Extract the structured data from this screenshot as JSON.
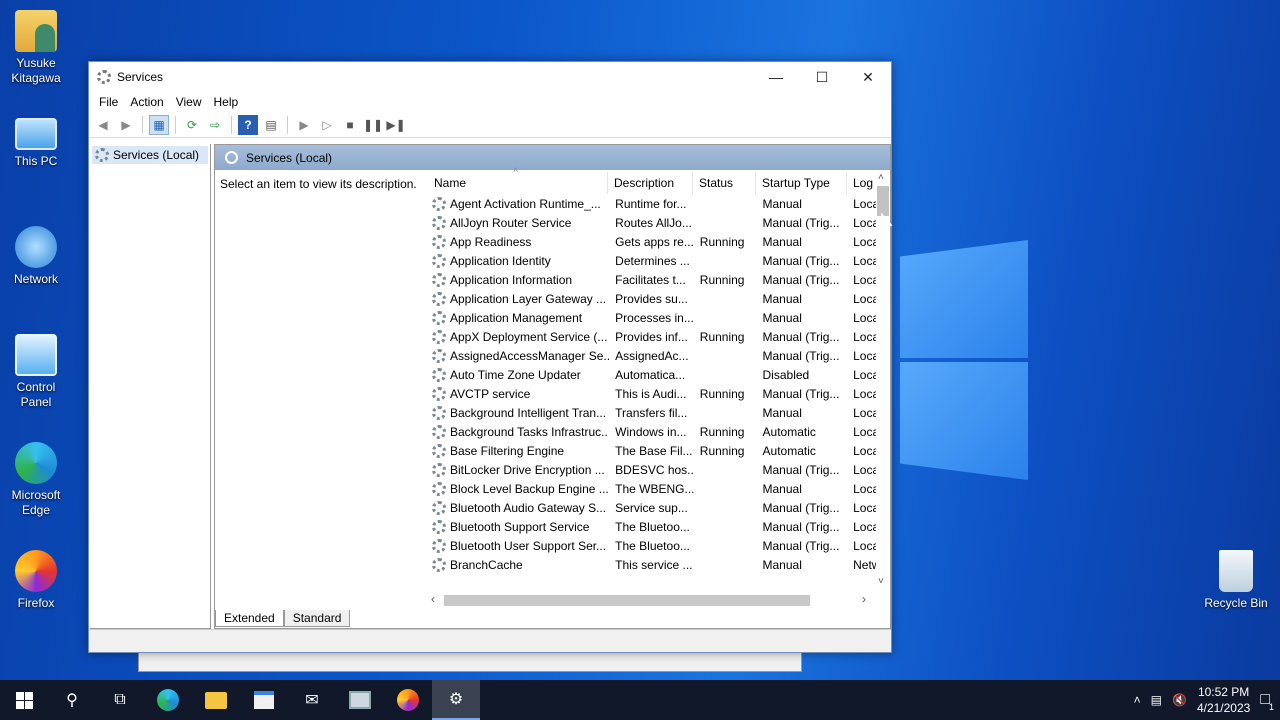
{
  "desktop": {
    "icons": [
      {
        "label": "Yusuke\nKitagawa",
        "icon": "user-folder-icon"
      },
      {
        "label": "This PC",
        "icon": "computer-icon"
      },
      {
        "label": "Network",
        "icon": "network-icon"
      },
      {
        "label": "Control\nPanel",
        "icon": "control-panel-icon"
      },
      {
        "label": "Microsoft\nEdge",
        "icon": "edge-icon"
      },
      {
        "label": "Firefox",
        "icon": "firefox-icon"
      },
      {
        "label": "Recycle Bin",
        "icon": "recycle-bin-icon"
      }
    ]
  },
  "window": {
    "title": "Services",
    "menu": [
      "File",
      "Action",
      "View",
      "Help"
    ],
    "tree_root": "Services (Local)",
    "panel_title": "Services (Local)",
    "description_prompt": "Select an item to view its description.",
    "columns": [
      "Name",
      "Description",
      "Status",
      "Startup Type",
      "Log"
    ],
    "rows": [
      [
        "Agent Activation Runtime_...",
        "Runtime for...",
        "",
        "Manual",
        "Loca"
      ],
      [
        "AllJoyn Router Service",
        "Routes AllJo...",
        "",
        "Manual (Trig...",
        "Loca"
      ],
      [
        "App Readiness",
        "Gets apps re...",
        "Running",
        "Manual",
        "Loca"
      ],
      [
        "Application Identity",
        "Determines ...",
        "",
        "Manual (Trig...",
        "Loca"
      ],
      [
        "Application Information",
        "Facilitates t...",
        "Running",
        "Manual (Trig...",
        "Loca"
      ],
      [
        "Application Layer Gateway ...",
        "Provides su...",
        "",
        "Manual",
        "Loca"
      ],
      [
        "Application Management",
        "Processes in...",
        "",
        "Manual",
        "Loca"
      ],
      [
        "AppX Deployment Service (...",
        "Provides inf...",
        "Running",
        "Manual (Trig...",
        "Loca"
      ],
      [
        "AssignedAccessManager Se...",
        "AssignedAc...",
        "",
        "Manual (Trig...",
        "Loca"
      ],
      [
        "Auto Time Zone Updater",
        "Automatica...",
        "",
        "Disabled",
        "Loca"
      ],
      [
        "AVCTP service",
        "This is Audi...",
        "Running",
        "Manual (Trig...",
        "Loca"
      ],
      [
        "Background Intelligent Tran...",
        "Transfers fil...",
        "",
        "Manual",
        "Loca"
      ],
      [
        "Background Tasks Infrastruc...",
        "Windows in...",
        "Running",
        "Automatic",
        "Loca"
      ],
      [
        "Base Filtering Engine",
        "The Base Fil...",
        "Running",
        "Automatic",
        "Loca"
      ],
      [
        "BitLocker Drive Encryption ...",
        "BDESVC hos...",
        "",
        "Manual (Trig...",
        "Loca"
      ],
      [
        "Block Level Backup Engine ...",
        "The WBENG...",
        "",
        "Manual",
        "Loca"
      ],
      [
        "Bluetooth Audio Gateway S...",
        "Service sup...",
        "",
        "Manual (Trig...",
        "Loca"
      ],
      [
        "Bluetooth Support Service",
        "The Bluetoo...",
        "",
        "Manual (Trig...",
        "Loca"
      ],
      [
        "Bluetooth User Support Ser...",
        "The Bluetoo...",
        "",
        "Manual (Trig...",
        "Loca"
      ],
      [
        "BranchCache",
        "This service ...",
        "",
        "Manual",
        "Netw"
      ]
    ],
    "tabs": [
      "Extended",
      "Standard"
    ]
  },
  "taskbar": {
    "time": "10:52 PM",
    "date": "4/21/2023",
    "notification_count": "1"
  }
}
